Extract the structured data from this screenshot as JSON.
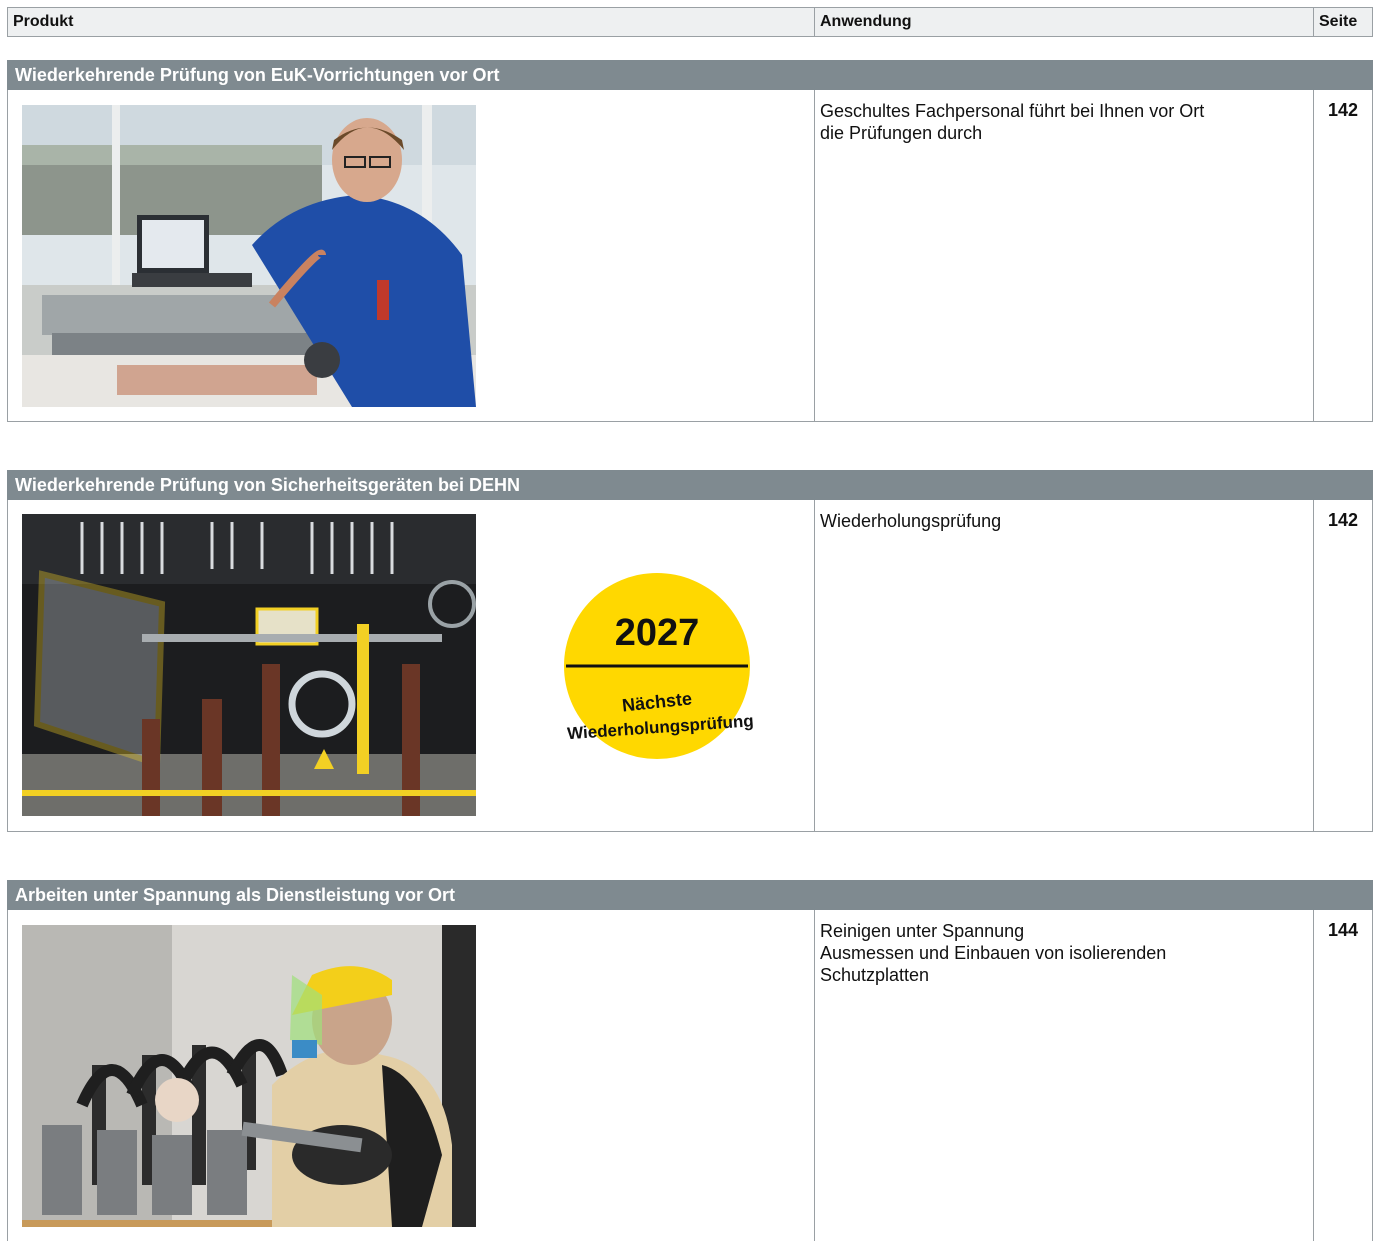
{
  "table_header": {
    "product": "Produkt",
    "application": "Anwendung",
    "page": "Seite"
  },
  "sections": [
    {
      "title": "Wiederkehrende Prüfung von EuK-Vorrichtungen vor Ort",
      "application_lines": [
        "Geschultes Fachpersonal führt bei Ihnen vor Ort",
        "die Prüfungen durch"
      ],
      "page": "142"
    },
    {
      "title": "Wiederkehrende Prüfung von Sicherheitsgeräten bei DEHN",
      "application_lines": [
        "Wiederholungsprüfung"
      ],
      "page": "142",
      "badge": {
        "year": "2027",
        "text_line1": "Nächste",
        "text_line2": "Wiederholungsprüfung"
      }
    },
    {
      "title": "Arbeiten unter Spannung als Dienstleistung vor Ort",
      "application_lines": [
        "Reinigen unter Spannung",
        "Ausmessen und Einbauen von isolierenden",
        "Schutzplatten"
      ],
      "page": "144"
    }
  ],
  "colors": {
    "section_bar": "#7f8a90",
    "badge_yellow": "#ffd800",
    "border": "#9aa0a4"
  }
}
